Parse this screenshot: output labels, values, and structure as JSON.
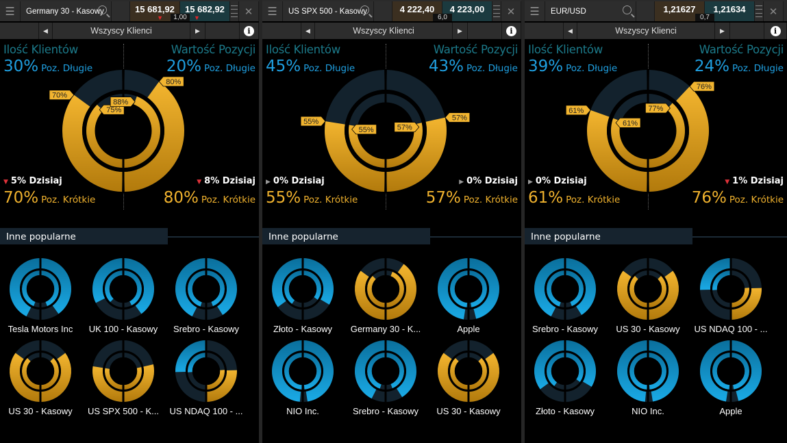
{
  "colors": {
    "long": "#1ba3e0",
    "short": "#f0b22e",
    "empty": "#13222d",
    "negative": "#e0323a"
  },
  "common": {
    "filter_label": "Wszyscy Klienci",
    "clients_title": "Ilość Klientów",
    "value_title": "Wartość Pozycji",
    "long_label": "Poz. Długie",
    "short_label": "Poz. Krótkie",
    "popular_title": "Inne popularne",
    "icons": {
      "menu": "hamburger-icon",
      "search": "search-icon",
      "close": "close-icon",
      "prev": "caret-left-icon",
      "next": "caret-right-icon",
      "info": "info-icon"
    }
  },
  "panels": [
    {
      "instrument": "Germany 30 - Kasowy",
      "bid": "15 681,92",
      "ask": "15 682,92",
      "spread": "1,00",
      "bid_dir": "down",
      "ask_dir": "down",
      "clients": {
        "long": "30%",
        "short": "70%",
        "today": "5% Dzisiaj",
        "today_dir": "down",
        "long_pct": 30
      },
      "value": {
        "long": "20%",
        "short": "80%",
        "today": "8% Dzisiaj",
        "today_dir": "down",
        "long_pct": 20
      },
      "inner": {
        "left_pct": 25,
        "right_pct": 12
      },
      "tags": {
        "outer_left": "70%",
        "outer_right": "80%",
        "inner_left": "75%",
        "inner_right": "88%"
      },
      "popular": [
        {
          "name": "Tesla Motors Inc",
          "outer": [
            85,
            80
          ],
          "inner": [
            88,
            88
          ]
        },
        {
          "name": "UK 100 - Kasowy",
          "outer": [
            65,
            80
          ],
          "inner": [
            75,
            85
          ]
        },
        {
          "name": "Srebro - Kasowy",
          "outer": [
            85,
            82
          ],
          "inner": [
            90,
            88
          ]
        },
        {
          "name": "US 30 - Kasowy",
          "outer": [
            30,
            30
          ],
          "inner": [
            25,
            25
          ]
        },
        {
          "name": "US SPX 500 - K...",
          "outer": [
            45,
            43
          ],
          "inner": [
            45,
            43
          ]
        },
        {
          "name": "US NDAQ 100 - ...",
          "outer": [
            51,
            49
          ],
          "inner": [
            52,
            48
          ]
        }
      ]
    },
    {
      "instrument": "US SPX 500 - Kasowy",
      "bid": "4 222,40",
      "ask": "4 223,00",
      "spread": "6,0",
      "bid_dir": "",
      "ask_dir": "",
      "clients": {
        "long": "45%",
        "short": "55%",
        "today": "0% Dzisiaj",
        "today_dir": "neutral",
        "long_pct": 45
      },
      "value": {
        "long": "43%",
        "short": "57%",
        "today": "0% Dzisiaj",
        "today_dir": "neutral",
        "long_pct": 43
      },
      "inner": {
        "left_pct": 45,
        "right_pct": 43
      },
      "tags": {
        "outer_left": "55%",
        "outer_right": "57%",
        "inner_left": "55%",
        "inner_right": "57%"
      },
      "popular": [
        {
          "name": "Złoto - Kasowy",
          "outer": [
            70,
            67
          ],
          "inner": [
            80,
            70
          ]
        },
        {
          "name": "Germany 30 - K...",
          "outer": [
            30,
            20
          ],
          "inner": [
            25,
            12
          ]
        },
        {
          "name": "Apple",
          "outer": [
            95,
            92
          ],
          "inner": [
            97,
            95
          ]
        },
        {
          "name": "NIO Inc.",
          "outer": [
            97,
            95
          ],
          "inner": [
            98,
            97
          ]
        },
        {
          "name": "Srebro - Kasowy",
          "outer": [
            85,
            82
          ],
          "inner": [
            90,
            88
          ]
        },
        {
          "name": "US 30 - Kasowy",
          "outer": [
            30,
            30
          ],
          "inner": [
            25,
            25
          ]
        }
      ]
    },
    {
      "instrument": "EUR/USD",
      "bid": "1,21627",
      "ask": "1,21634",
      "spread": "0,7",
      "bid_dir": "",
      "ask_dir": "",
      "clients": {
        "long": "39%",
        "short": "61%",
        "today": "0% Dzisiaj",
        "today_dir": "neutral",
        "long_pct": 39
      },
      "value": {
        "long": "24%",
        "short": "76%",
        "today": "1% Dzisiaj",
        "today_dir": "down",
        "long_pct": 24
      },
      "inner": {
        "left_pct": 39,
        "right_pct": 23
      },
      "tags": {
        "outer_left": "61%",
        "outer_right": "76%",
        "inner_left": "61%",
        "inner_right": "77%"
      },
      "popular": [
        {
          "name": "Srebro - Kasowy",
          "outer": [
            85,
            82
          ],
          "inner": [
            90,
            88
          ]
        },
        {
          "name": "US 30 - Kasowy",
          "outer": [
            30,
            30
          ],
          "inner": [
            25,
            25
          ]
        },
        {
          "name": "US NDAQ 100 - ...",
          "outer": [
            51,
            49
          ],
          "inner": [
            52,
            48
          ]
        },
        {
          "name": "Złoto - Kasowy",
          "outer": [
            70,
            67
          ],
          "inner": [
            80,
            70
          ]
        },
        {
          "name": "NIO Inc.",
          "outer": [
            97,
            95
          ],
          "inner": [
            98,
            97
          ]
        },
        {
          "name": "Apple",
          "outer": [
            95,
            92
          ],
          "inner": [
            97,
            95
          ]
        }
      ]
    }
  ]
}
